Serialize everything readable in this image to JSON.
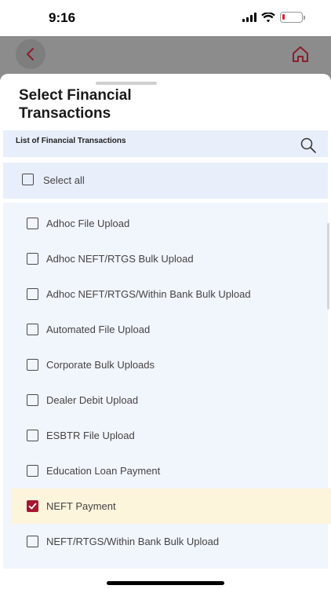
{
  "status_bar": {
    "time": "9:16",
    "battery_color": "#e0262f"
  },
  "header": {
    "back_icon": "chevron-left-icon",
    "home_icon": "home-icon",
    "accent": "#a8172f"
  },
  "sheet": {
    "title": "Select Financial Transactions",
    "list_header": "List of Financial Transactions",
    "search_icon": "search-icon",
    "select_all": {
      "label": "Select all",
      "checked": false
    },
    "items": [
      {
        "label": "Adhoc File Upload",
        "checked": false
      },
      {
        "label": "Adhoc NEFT/RTGS Bulk Upload",
        "checked": false
      },
      {
        "label": "Adhoc NEFT/RTGS/Within Bank Bulk Upload",
        "checked": false
      },
      {
        "label": "Automated File Upload",
        "checked": false
      },
      {
        "label": "Corporate Bulk Uploads",
        "checked": false
      },
      {
        "label": "Dealer Debit Upload",
        "checked": false
      },
      {
        "label": "ESBTR File Upload",
        "checked": false
      },
      {
        "label": "Education Loan Payment",
        "checked": false
      },
      {
        "label": "NEFT Payment",
        "checked": true
      },
      {
        "label": "NEFT/RTGS/Within Bank Bulk Upload",
        "checked": false
      }
    ]
  }
}
